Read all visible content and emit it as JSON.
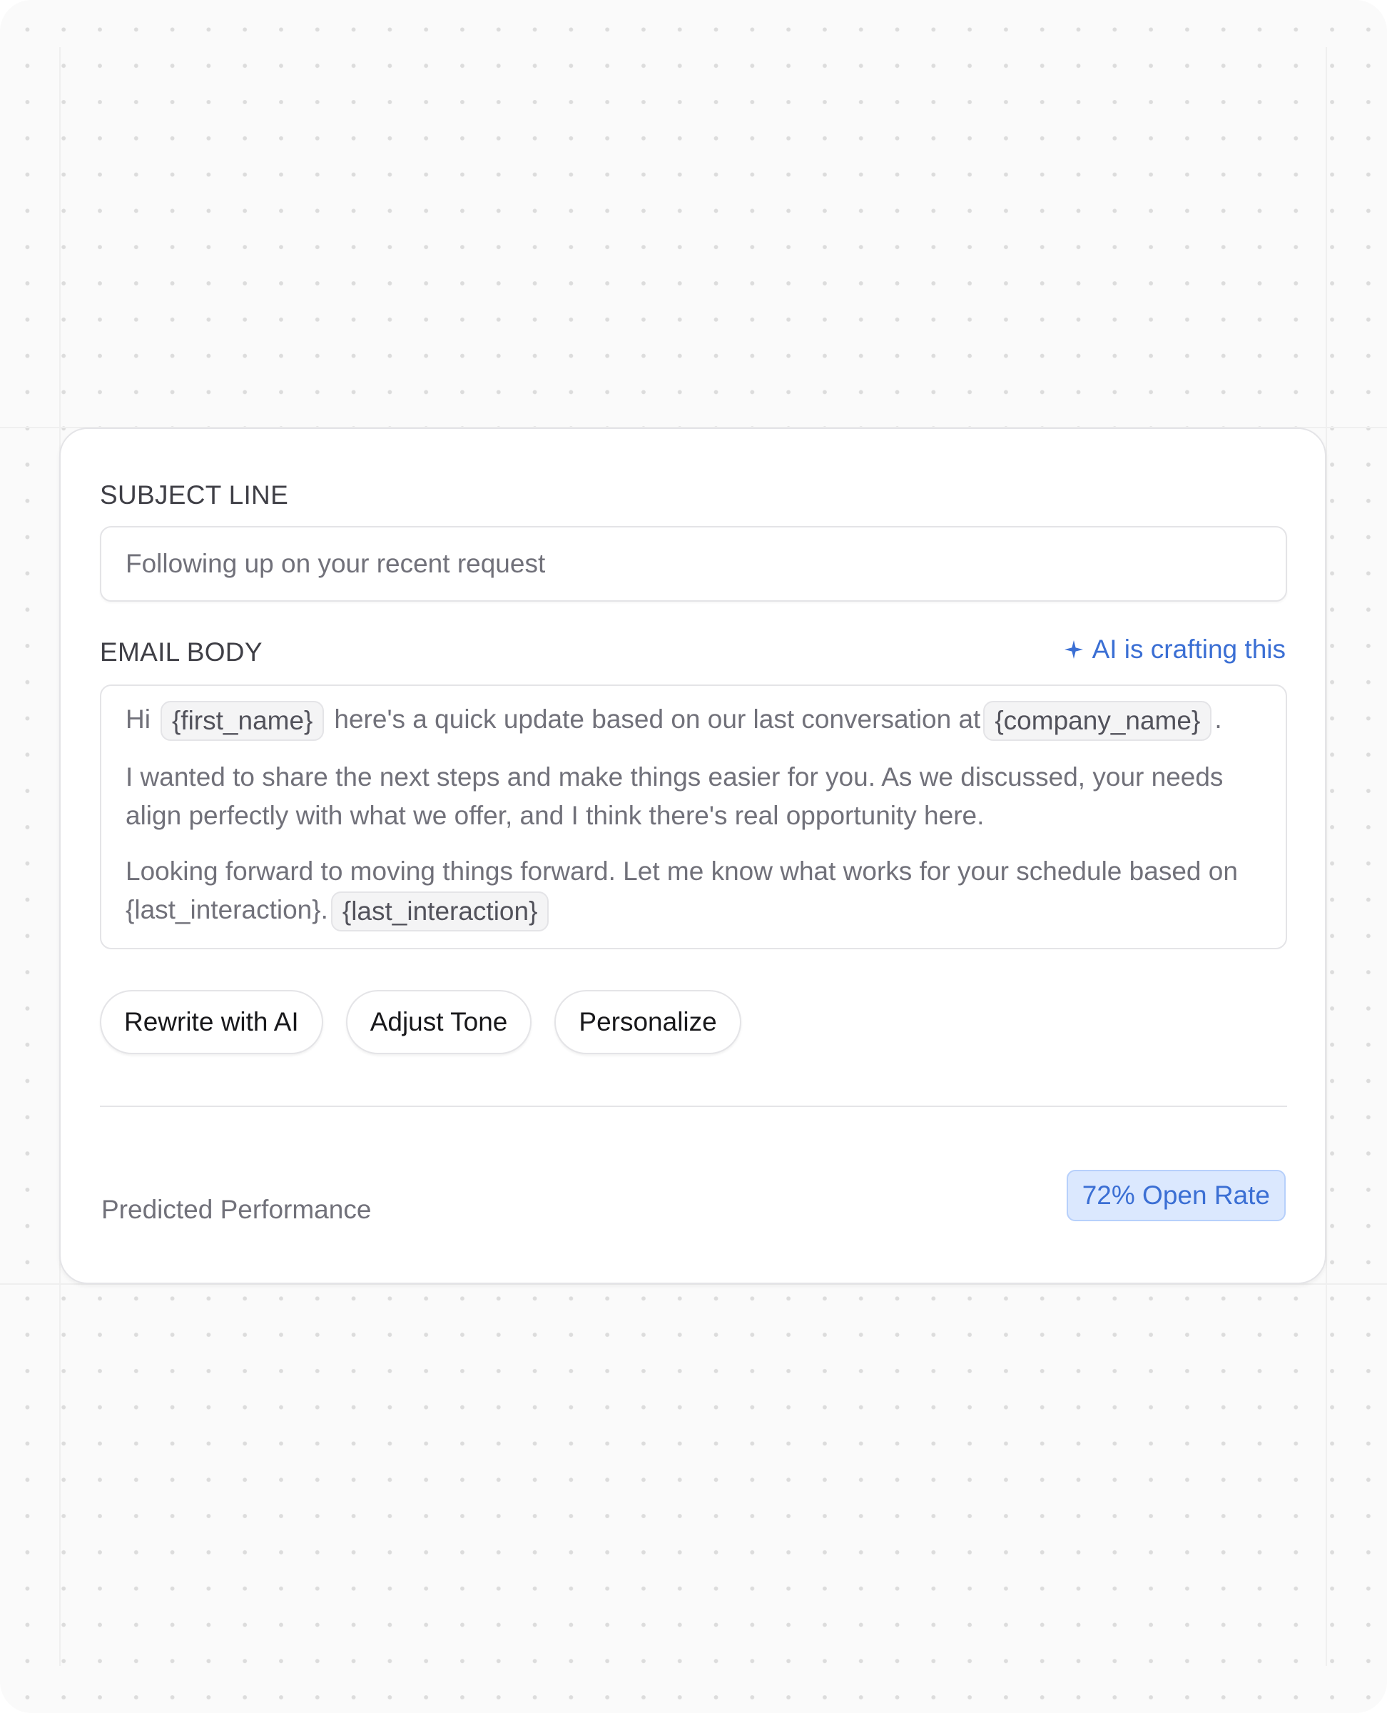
{
  "subject": {
    "label": "SUBJECT LINE",
    "value": "Following up on your recent request"
  },
  "email_body": {
    "label": "EMAIL BODY",
    "ai_status": "AI is crafting this",
    "ai_icon": "sparkle-icon",
    "line1": {
      "greeting": "Hi",
      "token_first_name": "{first_name}",
      "middle": "here's a quick update based on our last conversation at",
      "token_company_name": "{company_name}",
      "end": "."
    },
    "paragraph2": "I wanted to share the next steps and make things easier for you. As we discussed, your needs align perfectly with what we offer, and I think there's real opportunity here.",
    "paragraph3": "Looking forward to moving things forward. Let me know what works for your schedule based on {last_interaction}.",
    "token_last_interaction": "{last_interaction}"
  },
  "actions": {
    "rewrite_label": "Rewrite with AI",
    "tone_label": "Adjust Tone",
    "personalize_label": "Personalize"
  },
  "performance": {
    "label": "Predicted Performance",
    "badge": "72% Open Rate"
  },
  "colors": {
    "accent": "#3b6fd4",
    "badge_bg": "#dbe8fe",
    "text_muted": "#71717a"
  }
}
